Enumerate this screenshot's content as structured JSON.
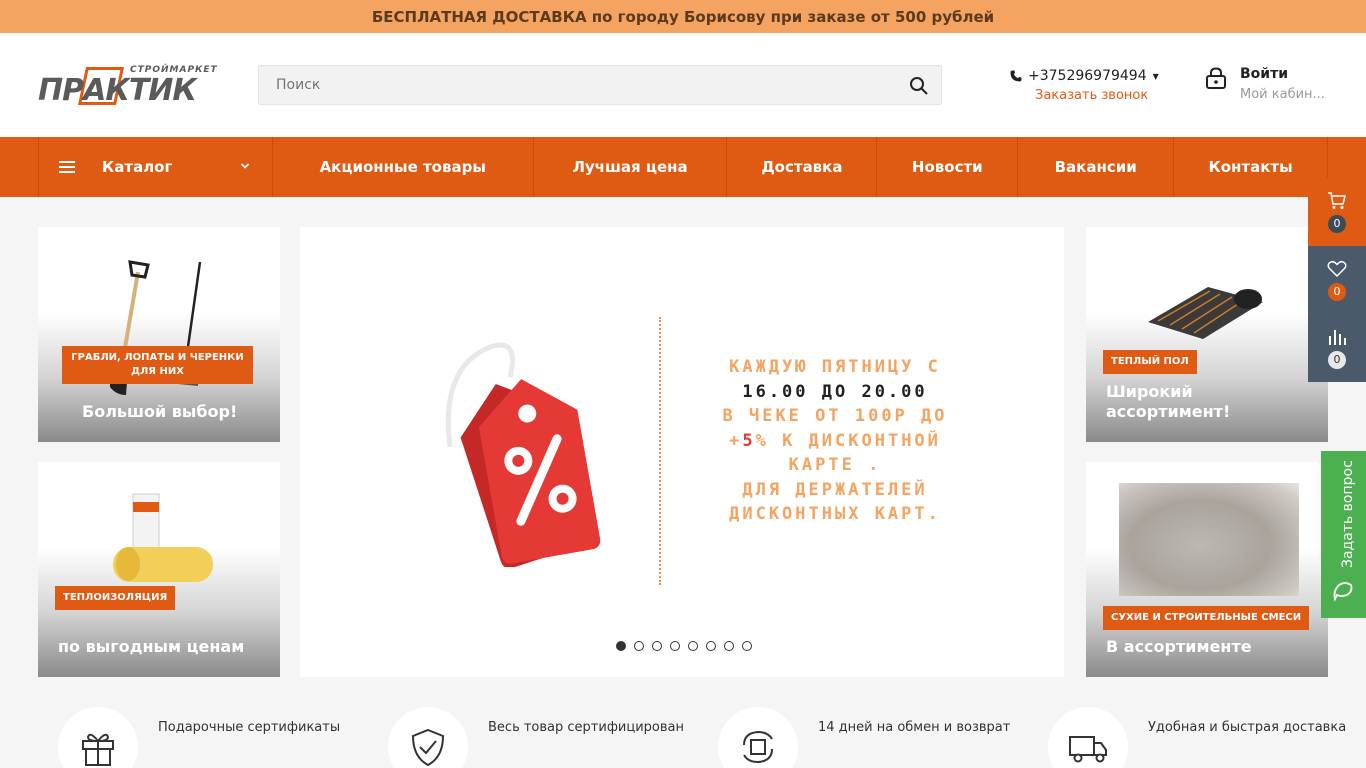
{
  "topbar": {
    "text": "БЕСПЛАТНАЯ ДОСТАВКА по городу Борисову при заказе от 500 рублей"
  },
  "header": {
    "logo": {
      "small": "СТРОЙМАРКЕТ",
      "main": "ПРАКТИК"
    },
    "search": {
      "placeholder": "Поиск",
      "icon": "search-icon"
    },
    "phone": {
      "number": "+375296979494",
      "callback": "Заказать звонок"
    },
    "login": {
      "title": "Войти",
      "subtitle": "Мой кабин..."
    }
  },
  "nav": {
    "catalog": "Каталог",
    "items": [
      "Акционные товары",
      "Лучшая цена",
      "Доставка",
      "Новости",
      "Вакансии",
      "Контакты"
    ]
  },
  "tiles": {
    "top_left": {
      "tag": "ГРАБЛИ, ЛОПАТЫ И ЧЕРЕНКИ ДЛЯ НИХ",
      "text": "Большой выбор!"
    },
    "bottom_left": {
      "tag": "ТЕПЛОИЗОЛЯЦИЯ",
      "text": "по выгодным ценам"
    },
    "top_right": {
      "tag": "ТЕПЛЫЙ ПОЛ",
      "text": "Широкий ассортимент!"
    },
    "bottom_right": {
      "tag": "СУХИЕ И СТРОИТЕЛЬНЫЕ СМЕСИ",
      "text": "В ассортименте"
    }
  },
  "slider": {
    "line1": "каждую пятницу с",
    "line2": "16.00 до 20.00",
    "line3": "в чеке от 100р до",
    "line4_plus": "+",
    "line4_num": "5",
    "line4_pct": "%",
    "line4_rest": " к дисконтной",
    "line5": "карте .",
    "line6": "для держателей",
    "line7": "дисконтных карт.",
    "dots_count": 8,
    "active_dot": 0
  },
  "floating": {
    "cart_count": "0",
    "favorites_count": "0",
    "compare_count": "0",
    "ask_label": "Задать вопрос"
  },
  "features": [
    {
      "icon": "gift-icon",
      "label": "Подарочные сертификаты"
    },
    {
      "icon": "shield-check-icon",
      "label": "Весь товар сертифицирован"
    },
    {
      "icon": "exchange-icon",
      "label": "14 дней на обмен и возврат"
    },
    {
      "icon": "truck-icon",
      "label": "Удобная и быстрая доставка"
    }
  ],
  "colors": {
    "accent": "#df5a12",
    "topbar": "#f4a361",
    "dark_panel": "#4a5a6b",
    "ask": "#4caf50"
  }
}
